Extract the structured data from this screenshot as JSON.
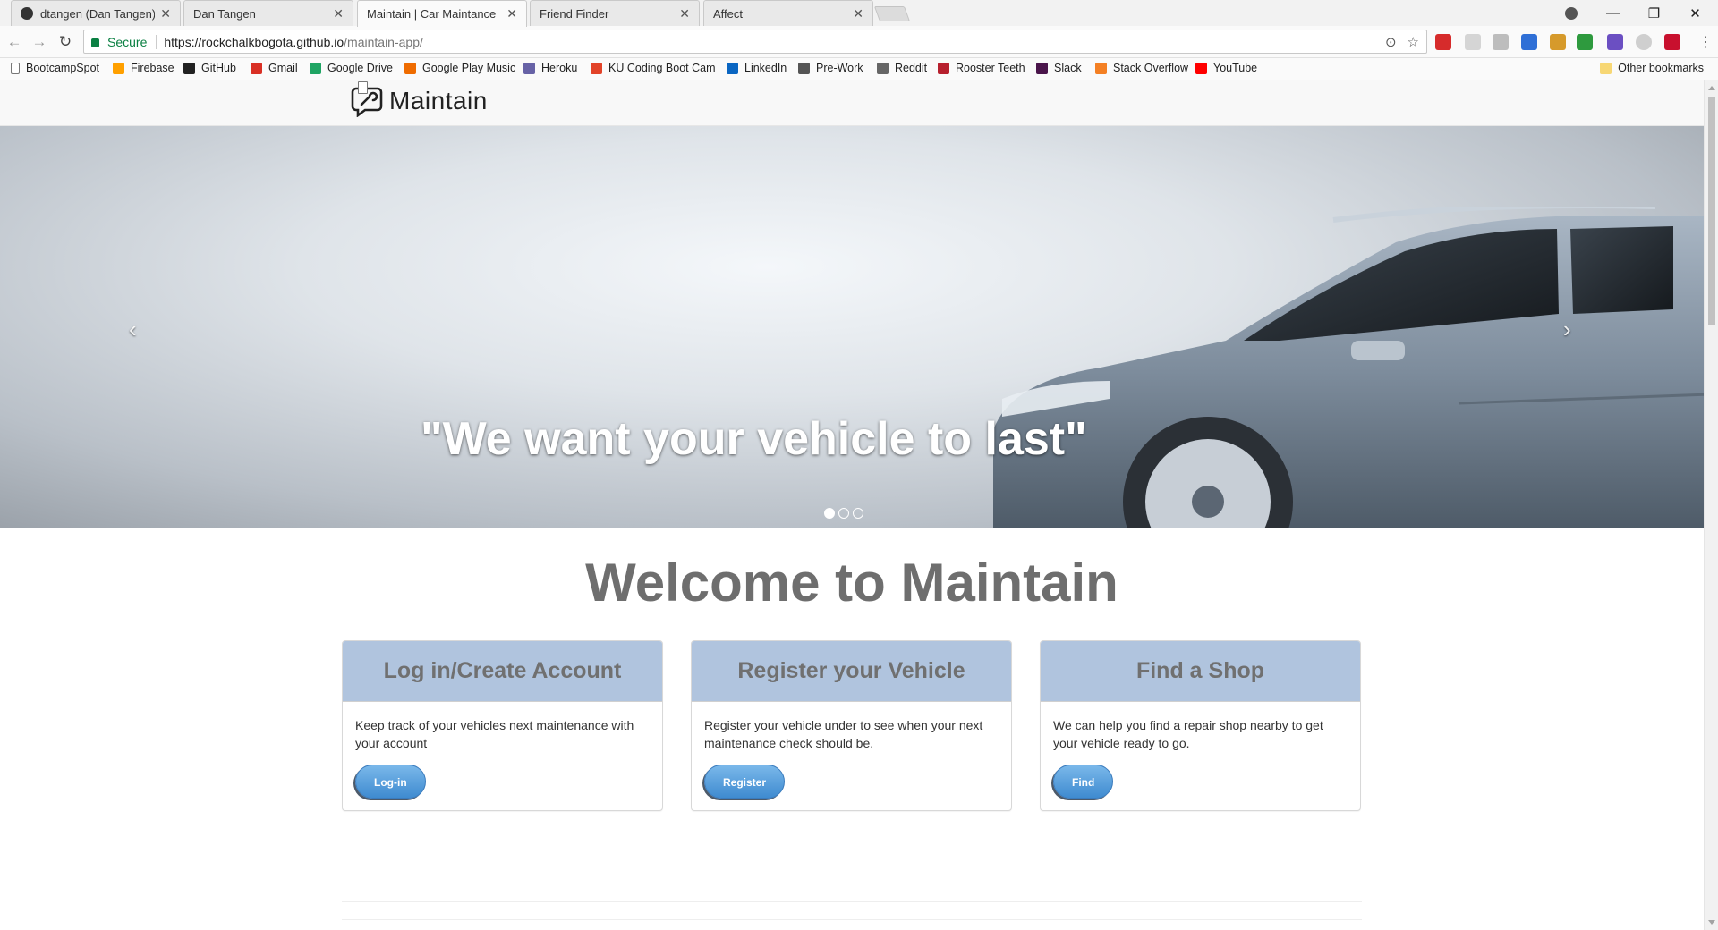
{
  "browser": {
    "tabs": [
      {
        "label": "dtangen (Dan Tangen)",
        "icon": "github-icon"
      },
      {
        "label": "Dan Tangen",
        "icon": "page-icon"
      },
      {
        "label": "Maintain | Car Maintance",
        "icon": "page-icon",
        "active": true
      },
      {
        "label": "Friend Finder",
        "icon": "page-icon"
      },
      {
        "label": "Affect",
        "icon": "page-icon"
      }
    ],
    "address": {
      "secure_label": "Secure",
      "host": "https://rockchalkbogota.github.io",
      "path": "/maintain-app/"
    },
    "bookmarks": [
      {
        "label": "BootcampSpot",
        "icon": "page-icon",
        "color": "#ffffff"
      },
      {
        "label": "Firebase",
        "icon": "firebase-icon",
        "color": "#ffa000"
      },
      {
        "label": "GitHub",
        "icon": "github-icon",
        "color": "#222222"
      },
      {
        "label": "Gmail",
        "icon": "gmail-icon",
        "color": "#d93025"
      },
      {
        "label": "Google Drive",
        "icon": "drive-icon",
        "color": "#1fa463"
      },
      {
        "label": "Google Play Music",
        "icon": "play-music-icon",
        "color": "#ef6c00"
      },
      {
        "label": "Heroku",
        "icon": "heroku-icon",
        "color": "#6762a6"
      },
      {
        "label": "KU Coding Boot Cam",
        "icon": "gitlab-icon",
        "color": "#e24329"
      },
      {
        "label": "LinkedIn",
        "icon": "linkedin-icon",
        "color": "#0a66c2"
      },
      {
        "label": "Pre-Work",
        "icon": "book-icon",
        "color": "#555555"
      },
      {
        "label": "Reddit",
        "icon": "reddit-icon",
        "color": "#666666"
      },
      {
        "label": "Rooster Teeth",
        "icon": "rooster-teeth-icon",
        "color": "#b7202e"
      },
      {
        "label": "Slack",
        "icon": "slack-icon",
        "color": "#4a154b"
      },
      {
        "label": "Stack Overflow",
        "icon": "stackoverflow-icon",
        "color": "#f48024"
      },
      {
        "label": "YouTube",
        "icon": "youtube-icon",
        "color": "#ff0000"
      }
    ],
    "other_bookmarks": "Other bookmarks"
  },
  "site": {
    "brand": "Maintain",
    "carousel": {
      "caption": "\"We want your vehicle to last\"",
      "prev_glyph": "‹",
      "next_glyph": "›",
      "slide_count": 3,
      "active_slide": 1
    },
    "welcome": "Welcome to Maintain",
    "panels": [
      {
        "title": "Log in/Create Account",
        "body": "Keep track of your vehicles next maintenance with your account",
        "button": "Log-in"
      },
      {
        "title": "Register your Vehicle",
        "body": "Register your vehicle under to see when your next maintenance check should be.",
        "button": "Register"
      },
      {
        "title": "Find a Shop",
        "body": "We can help you find a repair shop nearby to get your vehicle ready to go.",
        "button": "Find"
      }
    ],
    "colors": {
      "panel_header": "#b0c4de",
      "button": "#4a90d9",
      "secure": "#0b8043"
    }
  }
}
